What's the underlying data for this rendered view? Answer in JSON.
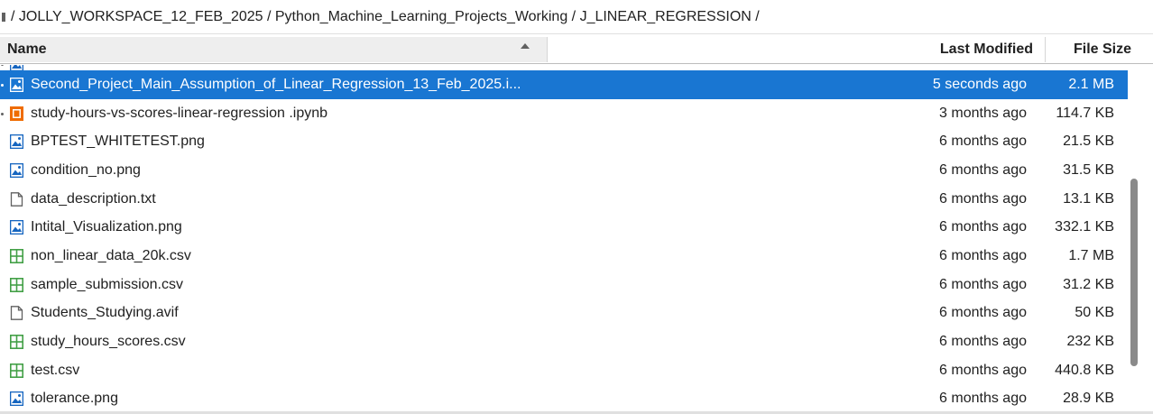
{
  "breadcrumb": {
    "path": "/ JOLLY_WORKSPACE_12_FEB_2025 / Python_Machine_Learning_Projects_Working / J_LINEAR_REGRESSION /"
  },
  "header": {
    "name": "Name",
    "last_modified": "Last Modified",
    "file_size": "File Size",
    "sort": "ascending"
  },
  "colors": {
    "selected": "#1976d2",
    "image_icon": "#1565c0",
    "notebook_icon": "#ef6c00",
    "csv_icon": "#43a047",
    "file_icon": "#616161"
  },
  "files": [
    {
      "name": "",
      "modified": "",
      "size": "",
      "icon": "image-icon"
    },
    {
      "name": "Second_Project_Main_Assumption_of_Linear_Regression_13_Feb_2025.i...",
      "modified": "5 seconds ago",
      "size": "2.1 MB",
      "icon": "image-icon",
      "selected": true
    },
    {
      "name": "study-hours-vs-scores-linear-regression .ipynb",
      "modified": "3 months ago",
      "size": "114.7 KB",
      "icon": "notebook-icon"
    },
    {
      "name": "BPTEST_WHITETEST.png",
      "modified": "6 months ago",
      "size": "21.5 KB",
      "icon": "image-icon"
    },
    {
      "name": "condition_no.png",
      "modified": "6 months ago",
      "size": "31.5 KB",
      "icon": "image-icon"
    },
    {
      "name": "data_description.txt",
      "modified": "6 months ago",
      "size": "13.1 KB",
      "icon": "file-icon"
    },
    {
      "name": "Intital_Visualization.png",
      "modified": "6 months ago",
      "size": "332.1 KB",
      "icon": "image-icon"
    },
    {
      "name": "non_linear_data_20k.csv",
      "modified": "6 months ago",
      "size": "1.7 MB",
      "icon": "csv-icon"
    },
    {
      "name": "sample_submission.csv",
      "modified": "6 months ago",
      "size": "31.2 KB",
      "icon": "csv-icon"
    },
    {
      "name": "Students_Studying.avif",
      "modified": "6 months ago",
      "size": "50 KB",
      "icon": "file-icon"
    },
    {
      "name": "study_hours_scores.csv",
      "modified": "6 months ago",
      "size": "232 KB",
      "icon": "csv-icon"
    },
    {
      "name": "test.csv",
      "modified": "6 months ago",
      "size": "440.8 KB",
      "icon": "csv-icon"
    },
    {
      "name": "tolerance.png",
      "modified": "6 months ago",
      "size": "28.9 KB",
      "icon": "image-icon"
    }
  ]
}
